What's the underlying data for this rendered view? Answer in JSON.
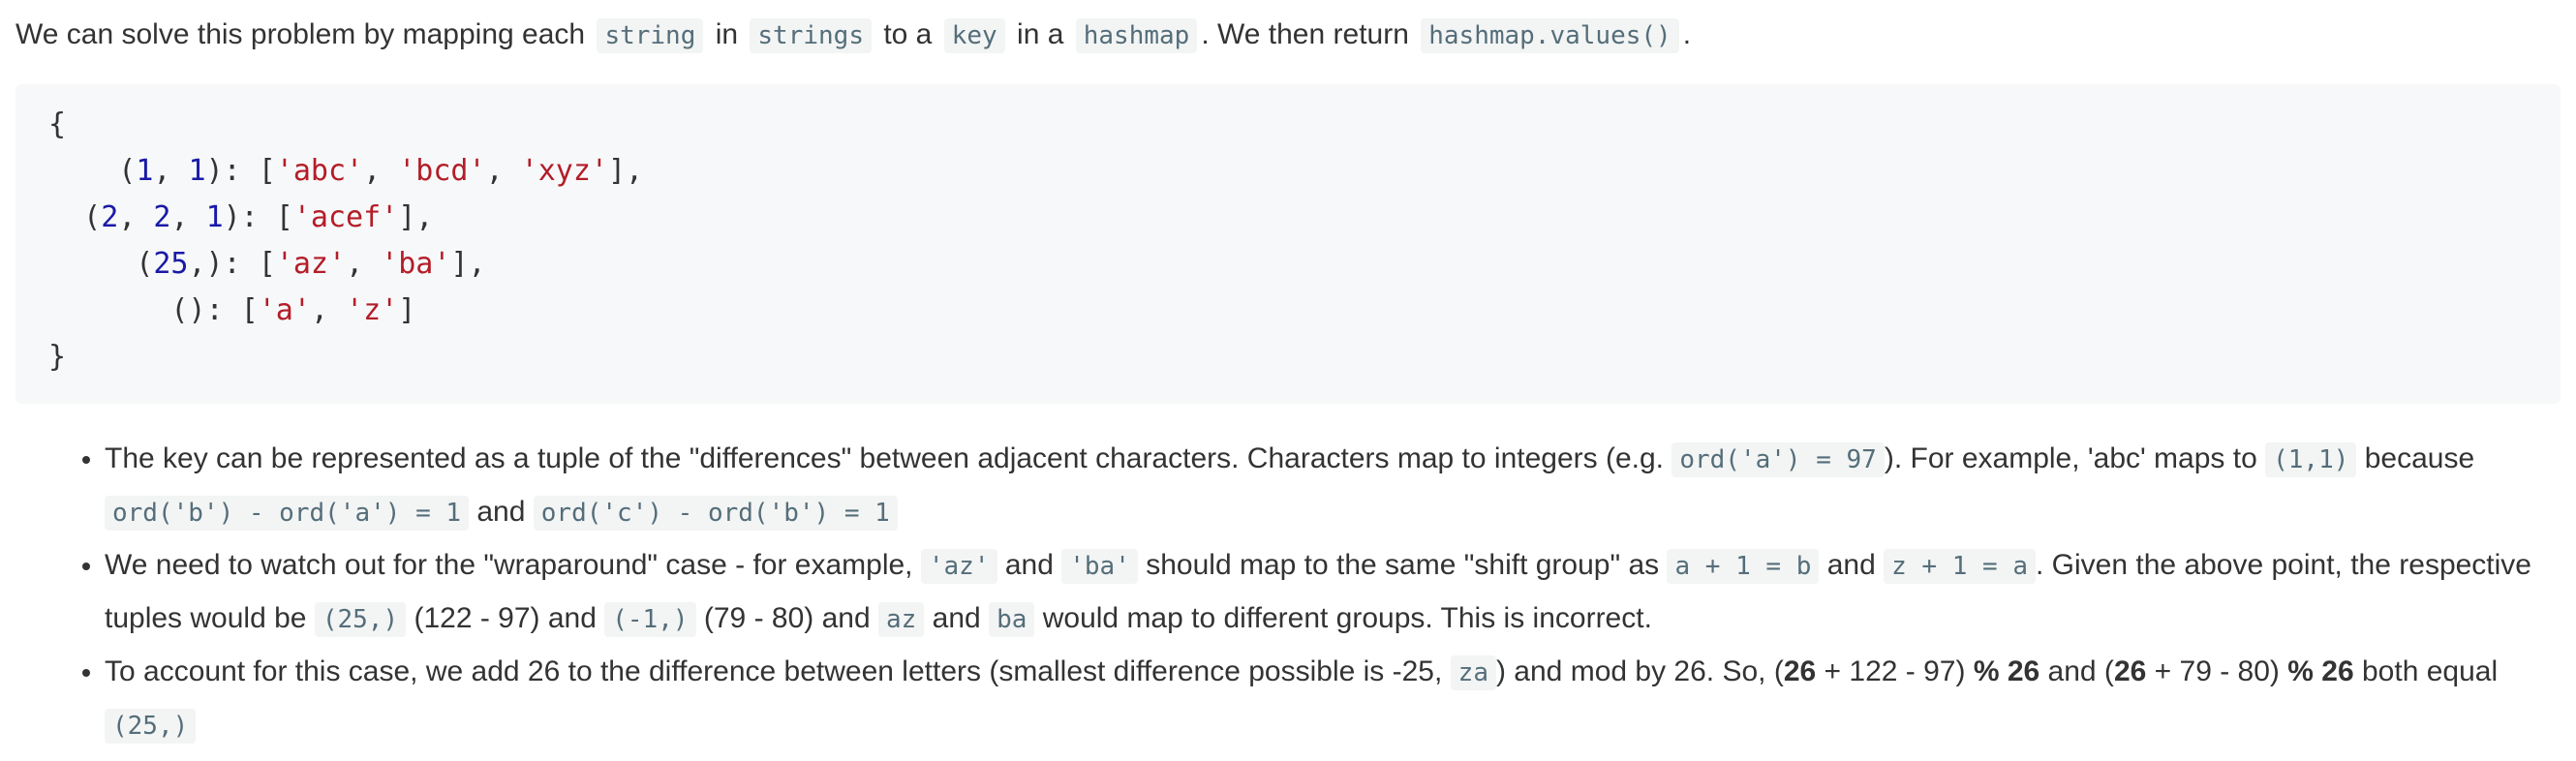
{
  "intro": {
    "t1": "We can solve this problem by mapping each",
    "c1": "string",
    "t2": "in",
    "c2": "strings",
    "t3": "to a",
    "c3": "key",
    "t4": "in a",
    "c4": "hashmap",
    "t5": ". We then return",
    "c5": "hashmap.values()",
    "t6": "."
  },
  "code_block": {
    "open": "{",
    "close": "}",
    "lines": [
      {
        "indent": "    ",
        "key_open": "(",
        "nums": [
          "1",
          "1"
        ],
        "key_close": "): ",
        "strs": [
          "'abc'",
          "'bcd'",
          "'xyz'"
        ],
        "tail": "],"
      },
      {
        "indent": "  ",
        "key_open": "(",
        "nums": [
          "2",
          "2",
          "1"
        ],
        "key_close": "): ",
        "strs": [
          "'acef'"
        ],
        "tail": "],"
      },
      {
        "indent": "     ",
        "key_open": "(",
        "nums": [
          "25"
        ],
        "key_close": ",): ",
        "strs": [
          "'az'",
          "'ba'"
        ],
        "tail": "],"
      },
      {
        "indent": "       ",
        "key_open": "()",
        "nums": [],
        "key_close": ": ",
        "strs": [
          "'a'",
          "'z'"
        ],
        "tail": "]"
      }
    ]
  },
  "bullets": {
    "b1": {
      "t1": "The key can be represented as a tuple of the \"differences\" between adjacent characters. Characters map to integers (e.g.",
      "c1": "ord('a') = 97",
      "t2": "). For example, 'abc' maps to",
      "c2": "(1,1)",
      "t3": "because",
      "c3": "ord('b') - ord('a') = 1",
      "t4": "and",
      "c4": "ord('c') - ord('b') = 1"
    },
    "b2": {
      "t1": "We need to watch out for the \"wraparound\" case - for example,",
      "c1": "'az'",
      "t2": "and",
      "c2": "'ba'",
      "t3": "should map to the same \"shift group\" as",
      "c3": "a + 1 = b",
      "t4": "and",
      "c4": "z + 1 = a",
      "t5": ". Given the above point, the respective tuples would be",
      "c5": "(25,)",
      "t6": "(122 - 97) and",
      "c6": "(-1,)",
      "t7": "(79 - 80) and",
      "c7": "az",
      "t8": "and",
      "c8": "ba",
      "t9": "would map to different groups. This is incorrect."
    },
    "b3": {
      "t1": "To account for this case, we add 26 to the difference between letters (smallest difference possible is -25,",
      "c1": "za",
      "t2": ") and mod by 26. So, (",
      "b1": "26",
      "t3": "+ 122 - 97)",
      "b2": "% 26",
      "t4": "and (",
      "b3": "26",
      "t5": "+ 79 - 80)",
      "b4": "% 26",
      "t6": "both equal",
      "c2": "(25,)"
    }
  }
}
